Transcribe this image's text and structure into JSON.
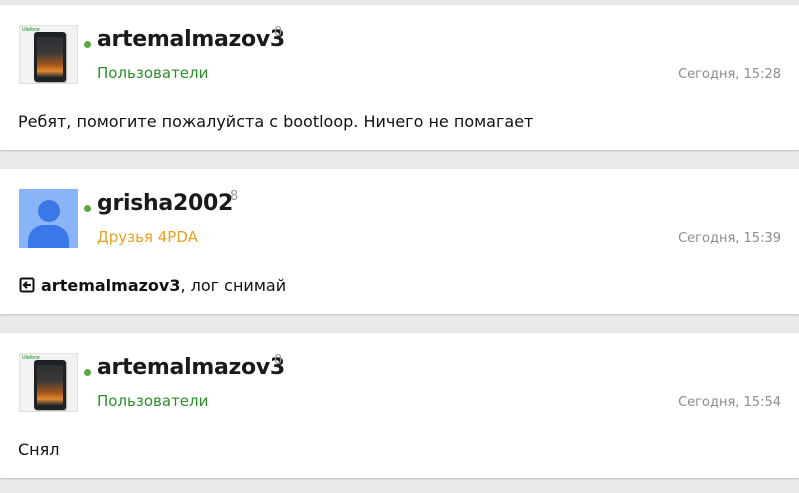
{
  "posts": [
    {
      "author": "artemalmazov3",
      "reputation": "0",
      "group": "Пользователи",
      "time": "Сегодня, 15:28",
      "text": "Ребят, помогите пожалуйста с bootloop. Ничего не помагает",
      "avatar_icon": "phone-avatar-icon"
    },
    {
      "author": "grisha2002",
      "reputation": "8",
      "group": "Друзья 4PDA",
      "time": "Сегодня, 15:39",
      "reply_to": "artemalmazov3",
      "text": ", лог снимай",
      "avatar_icon": "default-user-avatar-icon"
    },
    {
      "author": "artemalmazov3",
      "reputation": "0",
      "group": "Пользователи",
      "time": "Сегодня, 15:54",
      "text": "Снял",
      "avatar_icon": "phone-avatar-icon"
    }
  ],
  "colors": {
    "online": "#5aa844",
    "group_users": "#2b8f2b",
    "group_friends": "#e6a321",
    "timestamp": "#8d8d8d"
  }
}
